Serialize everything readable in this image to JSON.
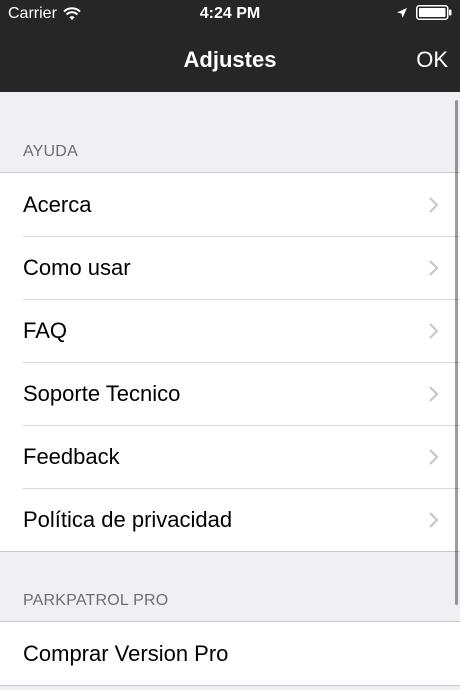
{
  "status_bar": {
    "carrier": "Carrier",
    "time": "4:24 PM",
    "icons": [
      "wifi-icon",
      "location-icon",
      "battery-icon"
    ]
  },
  "nav": {
    "title": "Adjustes",
    "done_label": "OK"
  },
  "sections": [
    {
      "header": "AYUDA",
      "items": [
        {
          "label": "Acerca"
        },
        {
          "label": "Como usar"
        },
        {
          "label": "FAQ"
        },
        {
          "label": "Soporte Tecnico"
        },
        {
          "label": "Feedback"
        },
        {
          "label": "Política de privacidad"
        }
      ]
    },
    {
      "header": "PARKPATROL PRO",
      "items": [
        {
          "label": "Comprar Version Pro"
        }
      ]
    }
  ],
  "colors": {
    "bar_background": "#262626",
    "page_background": "#efeff4",
    "section_header_text": "#6d6d72",
    "chevron": "#c7c7cc"
  }
}
